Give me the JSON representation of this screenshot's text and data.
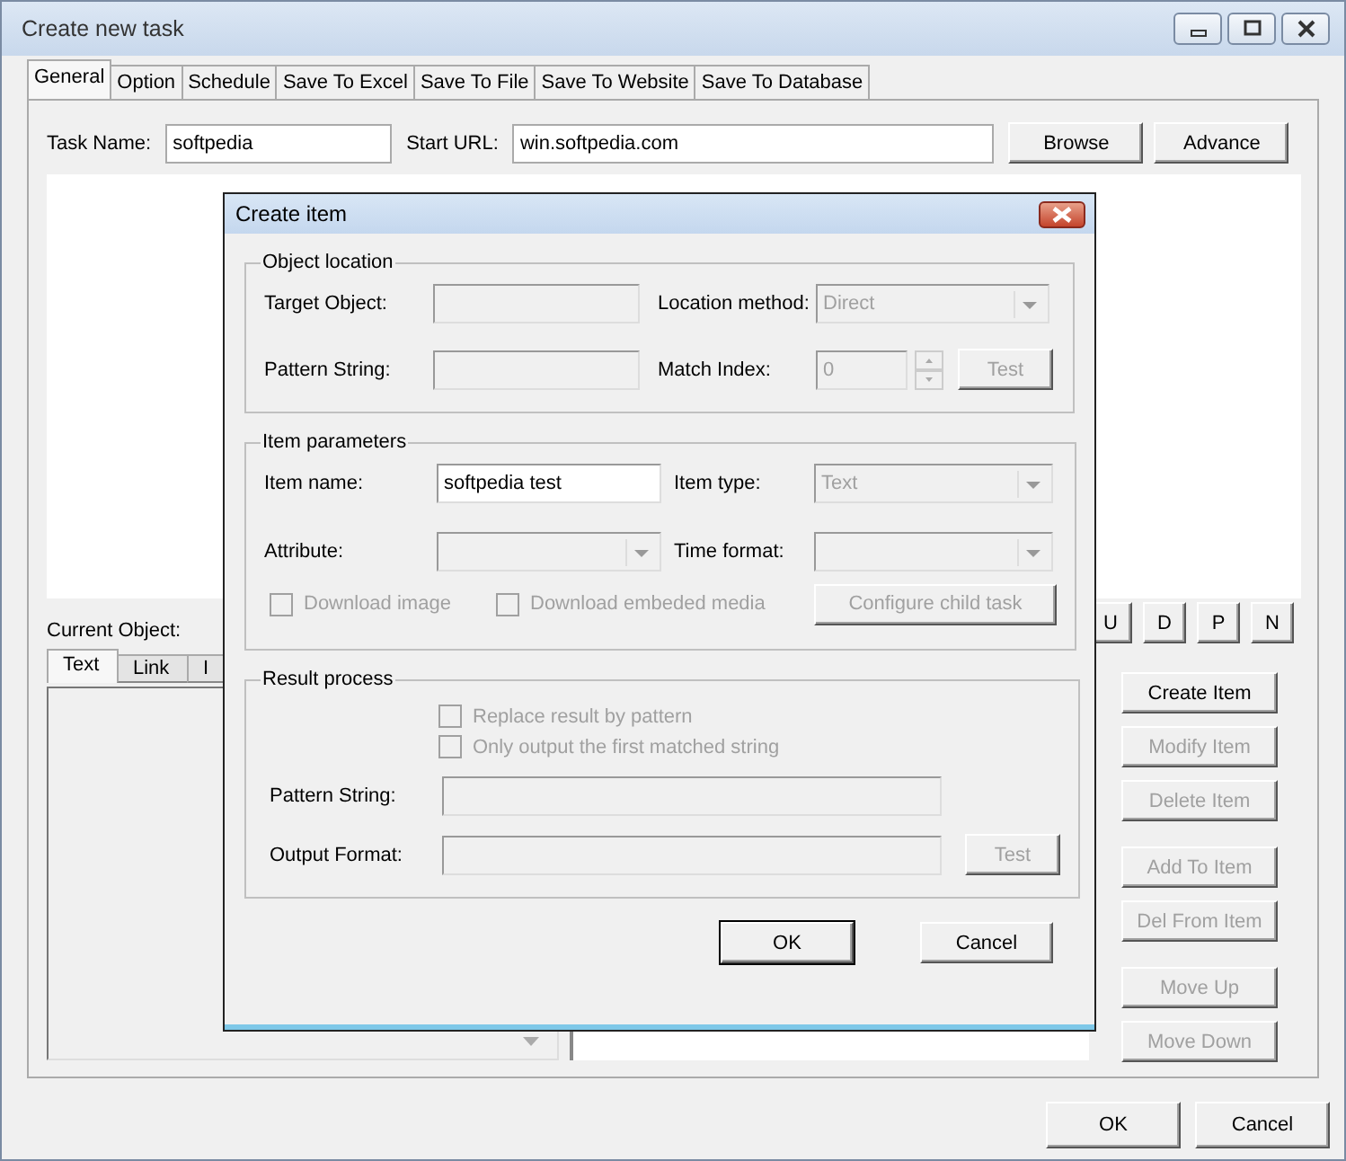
{
  "window": {
    "title": "Create new task"
  },
  "tabs": [
    {
      "label": "General",
      "selected": true
    },
    {
      "label": "Option",
      "selected": false
    },
    {
      "label": "Schedule",
      "selected": false
    },
    {
      "label": "Save To Excel",
      "selected": false
    },
    {
      "label": "Save To File",
      "selected": false
    },
    {
      "label": "Save To Website",
      "selected": false
    },
    {
      "label": "Save To Database",
      "selected": false
    }
  ],
  "task_name": {
    "label": "Task Name:",
    "value": "softpedia"
  },
  "start_url": {
    "label": "Start URL:",
    "value": "win.softpedia.com"
  },
  "top_buttons": [
    "Browse",
    "Advance"
  ],
  "current_object": {
    "label": "Current Object:",
    "tabs": [
      {
        "label": "Text",
        "selected": true
      },
      {
        "label": "Link",
        "selected": false
      },
      {
        "label": "I",
        "selected": false
      }
    ]
  },
  "nav_buttons": [
    "U",
    "D",
    "P",
    "N"
  ],
  "item_buttons": [
    {
      "label": "Create Item",
      "disabled": false
    },
    {
      "label": "Modify Item",
      "disabled": true
    },
    {
      "label": "Delete Item",
      "disabled": true
    },
    {
      "label": "Add To Item",
      "disabled": true
    },
    {
      "label": "Del From Item",
      "disabled": true
    },
    {
      "label": "Move Up",
      "disabled": true
    },
    {
      "label": "Move Down",
      "disabled": true
    }
  ],
  "buttons": [
    "OK",
    "Cancel"
  ],
  "dialog": {
    "title": "Create item",
    "object_location": {
      "title": "Object location",
      "target_object": {
        "label": "Target Object:",
        "disabled": true
      },
      "location_method": {
        "label": "Location method:",
        "value": "Direct",
        "disabled": true
      },
      "pattern_string": {
        "label": "Pattern String:",
        "disabled": true
      },
      "match_index": {
        "label": "Match Index:",
        "value": "0",
        "disabled": true
      },
      "test_button": {
        "label": "Test",
        "disabled": true
      }
    },
    "item_parameters": {
      "title": "Item parameters",
      "item_name": {
        "label": "Item name:",
        "value": "softpedia test",
        "disabled": false
      },
      "item_type": {
        "label": "Item type:",
        "value": "Text",
        "disabled": true
      },
      "attribute": {
        "label": "Attribute:",
        "disabled": true
      },
      "time_format": {
        "label": "Time format:",
        "disabled": true
      },
      "checkboxes": [
        {
          "label": "Download image",
          "checked": false,
          "disabled": true
        },
        {
          "label": "Download embeded media",
          "checked": false,
          "disabled": true
        }
      ],
      "configure_button": {
        "label": "Configure child task",
        "disabled": true
      }
    },
    "result_process": {
      "title": "Result process",
      "checkboxes": [
        {
          "label": "Replace result by pattern",
          "checked": false,
          "disabled": true
        },
        {
          "label": "Only output the first matched string",
          "checked": false,
          "disabled": true
        }
      ],
      "pattern_string": {
        "label": "Pattern String:",
        "disabled": true
      },
      "output_format": {
        "label": "Output Format:",
        "disabled": true
      },
      "test_button": {
        "label": "Test",
        "disabled": true
      }
    },
    "buttons": [
      "OK",
      "Cancel"
    ]
  }
}
